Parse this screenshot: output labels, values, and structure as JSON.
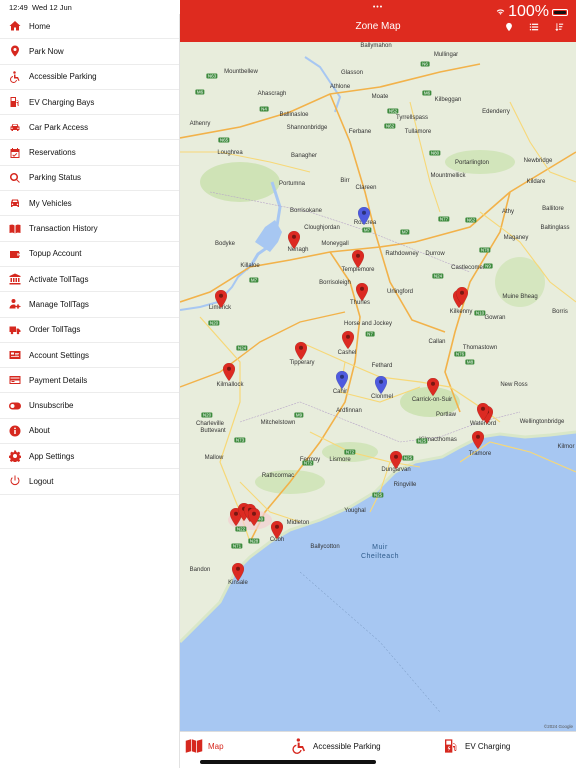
{
  "status": {
    "time": "12:49",
    "date": "Wed 12 Jun",
    "battery": "100%"
  },
  "header": {
    "title": "Zone Map",
    "dots": "•••"
  },
  "menu": [
    {
      "label": "Home",
      "icon": "home-icon"
    },
    {
      "label": "Park Now",
      "icon": "location-pin-icon"
    },
    {
      "label": "Accessible Parking",
      "icon": "wheelchair-icon"
    },
    {
      "label": "EV Charging Bays",
      "icon": "ev-charger-icon"
    },
    {
      "label": "Car Park Access",
      "icon": "car-icon"
    },
    {
      "label": "Reservations",
      "icon": "calendar-check-icon"
    },
    {
      "label": "Parking Status",
      "icon": "search-icon"
    },
    {
      "label": "My Vehicles",
      "icon": "car-front-icon"
    },
    {
      "label": "Transaction History",
      "icon": "book-icon"
    },
    {
      "label": "Topup Account",
      "icon": "wallet-icon"
    },
    {
      "label": "Activate TollTags",
      "icon": "bank-icon"
    },
    {
      "label": "Manage TollTags",
      "icon": "user-gear-icon"
    },
    {
      "label": "Order TollTags",
      "icon": "truck-icon"
    },
    {
      "label": "Account Settings",
      "icon": "id-card-icon"
    },
    {
      "label": "Payment Details",
      "icon": "credit-card-icon"
    },
    {
      "label": "Unsubscribe",
      "icon": "toggle-icon"
    },
    {
      "label": "About",
      "icon": "info-icon"
    },
    {
      "label": "App Settings",
      "icon": "gear-icon"
    },
    {
      "label": "Logout",
      "icon": "power-icon"
    }
  ],
  "map": {
    "places": [
      "Ballymahon",
      "Mullingar",
      "Mountbellew",
      "Glasson",
      "Ahascragh",
      "Athlone",
      "Moate",
      "Kilbeggan",
      "Ballinasloe",
      "Tyrrellspass",
      "Edenderry",
      "Athenry",
      "Shannonbridge",
      "Ferbane",
      "Tullamore",
      "Loughrea",
      "Banagher",
      "Portarlington",
      "Newbridge",
      "Portumna",
      "Birr",
      "Clareen",
      "Mountmellick",
      "Kildare",
      "Borrisokane",
      "Roscrea",
      "Athy",
      "Ballitore",
      "Bodyke",
      "Nenagh",
      "Cloughjordan",
      "Moneygall",
      "Maganey",
      "Baltinglass",
      "Killaloe",
      "Rathdowney",
      "Durrow",
      "Castlecomer",
      "Templemore",
      "Borrisoleigh",
      "Urlingford",
      "Muine Bheag",
      "Limerick",
      "Thurles",
      "Kilkenny",
      "Gowran",
      "Borris",
      "Horse and Jockey",
      "Callan",
      "Thomastown",
      "Tipperary",
      "Cashel",
      "Fethard",
      "Kilmallock",
      "Cahir",
      "Clonmel",
      "Carrick-on-Suir",
      "New Ross",
      "Ardfinnan",
      "Portlaw",
      "Charleville",
      "Waterford",
      "Wellingtonbridge",
      "Mitchelstown",
      "Kilmacthomas",
      "Buttevant",
      "Tramore",
      "Mallow",
      "Fermoy",
      "Lismore",
      "Dungarvan",
      "Rathcormac",
      "Ringville",
      "Youghal",
      "Midleton",
      "Cobh",
      "Ballycotton",
      "Bandon",
      "Kinsale",
      "Kilmor"
    ],
    "sea_label": [
      "Muir",
      "Cheilteach"
    ],
    "roads": [
      "N63",
      "N6",
      "M6",
      "N52",
      "N4",
      "M6",
      "N62",
      "N65",
      "N80",
      "M7",
      "N62",
      "N77",
      "N78",
      "M7",
      "N9",
      "N24",
      "N10",
      "N76",
      "M8",
      "N7",
      "M7",
      "N20",
      "N24",
      "M9",
      "N25",
      "N20",
      "N73",
      "N72",
      "N72",
      "N25",
      "N25",
      "N22",
      "N71",
      "N28",
      "N40"
    ],
    "copyright": "©2024 Google",
    "pins": [
      {
        "name": "pin-roscrea",
        "color": "#4f5bdf"
      },
      {
        "name": "pin-nenagh",
        "color": "#dc2a22"
      },
      {
        "name": "pin-templemore",
        "color": "#dc2a22"
      },
      {
        "name": "pin-limerick",
        "color": "#dc2a22"
      },
      {
        "name": "pin-thurles",
        "color": "#dc2a22"
      },
      {
        "name": "pin-kilkenny-1",
        "color": "#dc2a22"
      },
      {
        "name": "pin-kilkenny-2",
        "color": "#dc2a22"
      },
      {
        "name": "pin-cashel",
        "color": "#dc2a22"
      },
      {
        "name": "pin-tipperary",
        "color": "#dc2a22"
      },
      {
        "name": "pin-kilmallock",
        "color": "#dc2a22"
      },
      {
        "name": "pin-cahir",
        "color": "#4f5bdf"
      },
      {
        "name": "pin-clonmel",
        "color": "#4f5bdf"
      },
      {
        "name": "pin-carrick",
        "color": "#dc2a22"
      },
      {
        "name": "pin-waterford-1",
        "color": "#dc2a22"
      },
      {
        "name": "pin-waterford-2",
        "color": "#dc2a22"
      },
      {
        "name": "pin-tramore",
        "color": "#dc2a22"
      },
      {
        "name": "pin-dungarvan",
        "color": "#dc2a22"
      },
      {
        "name": "pin-cork-1",
        "color": "#dc2a22"
      },
      {
        "name": "pin-cork-2",
        "color": "#dc2a22"
      },
      {
        "name": "pin-cork-3",
        "color": "#dc2a22"
      },
      {
        "name": "pin-cork-4",
        "color": "#dc2a22"
      },
      {
        "name": "pin-cobh",
        "color": "#dc2a22"
      },
      {
        "name": "pin-kinsale",
        "color": "#dc2a22"
      }
    ]
  },
  "tabs": [
    {
      "label": "Map",
      "icon": "map-icon"
    },
    {
      "label": "Accessible Parking",
      "icon": "wheelchair-icon"
    },
    {
      "label": "EV Charging",
      "icon": "ev-charger-icon"
    }
  ],
  "colors": {
    "brand": "#de2b1f",
    "pin_red": "#dc2a22",
    "pin_blue": "#4f5bdf",
    "sea": "#a7c7f2",
    "land": "#e8eddc"
  }
}
